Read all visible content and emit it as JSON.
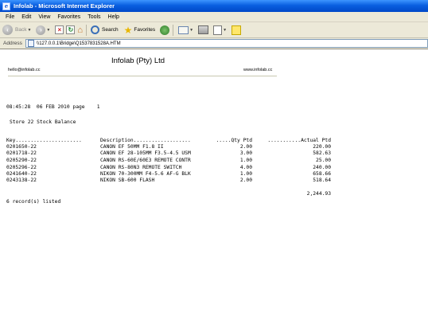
{
  "window": {
    "title": "Infolab - Microsoft Internet Explorer"
  },
  "menu": [
    "File",
    "Edit",
    "View",
    "Favorites",
    "Tools",
    "Help"
  ],
  "toolbar": {
    "back": "Back",
    "search": "Search",
    "favorites": "Favorites"
  },
  "address": {
    "label": "Address",
    "url": "\\\\127.0.0.1\\Bridge\\Q1537831528A.HTM"
  },
  "report": {
    "company": "Infolab (Pty) Ltd",
    "email": "hello@infolab.cc",
    "web": "www.infolab.cc",
    "datetime_line": "08:45:28  06 FEB 2010 page    1",
    "title": "Store 22 Stock Balance",
    "headers": {
      "key": "Key......................",
      "description": "Description...................",
      "qty": ".....Qty Ptd",
      "actual": "...........Actual Ptd"
    },
    "rows": [
      {
        "key": "0201650-22",
        "description": "CANON EF 50MM F1.8 II",
        "qty": "2.00",
        "actual": "220.00"
      },
      {
        "key": "0201718-22",
        "description": "CANON EF 28-105MM F3.5-4.5 USM",
        "qty": "3.00",
        "actual": "582.63"
      },
      {
        "key": "0205290-22",
        "description": "CANON RS-60E/60E3 REMOTE CONTR",
        "qty": "1.00",
        "actual": "25.00"
      },
      {
        "key": "0205296-22",
        "description": "CANON RS-80N3 REMOTE SWITCH",
        "qty": "4.00",
        "actual": "240.00"
      },
      {
        "key": "0241640-22",
        "description": "NIKON 70-300MM F4-5.6 AF-G BLK",
        "qty": "1.00",
        "actual": "658.66"
      },
      {
        "key": "0243138-22",
        "description": "NIKON SB-600 FLASH",
        "qty": "2.00",
        "actual": "518.64"
      }
    ],
    "total": "2,244.93",
    "footer": "6 record(s) listed"
  }
}
